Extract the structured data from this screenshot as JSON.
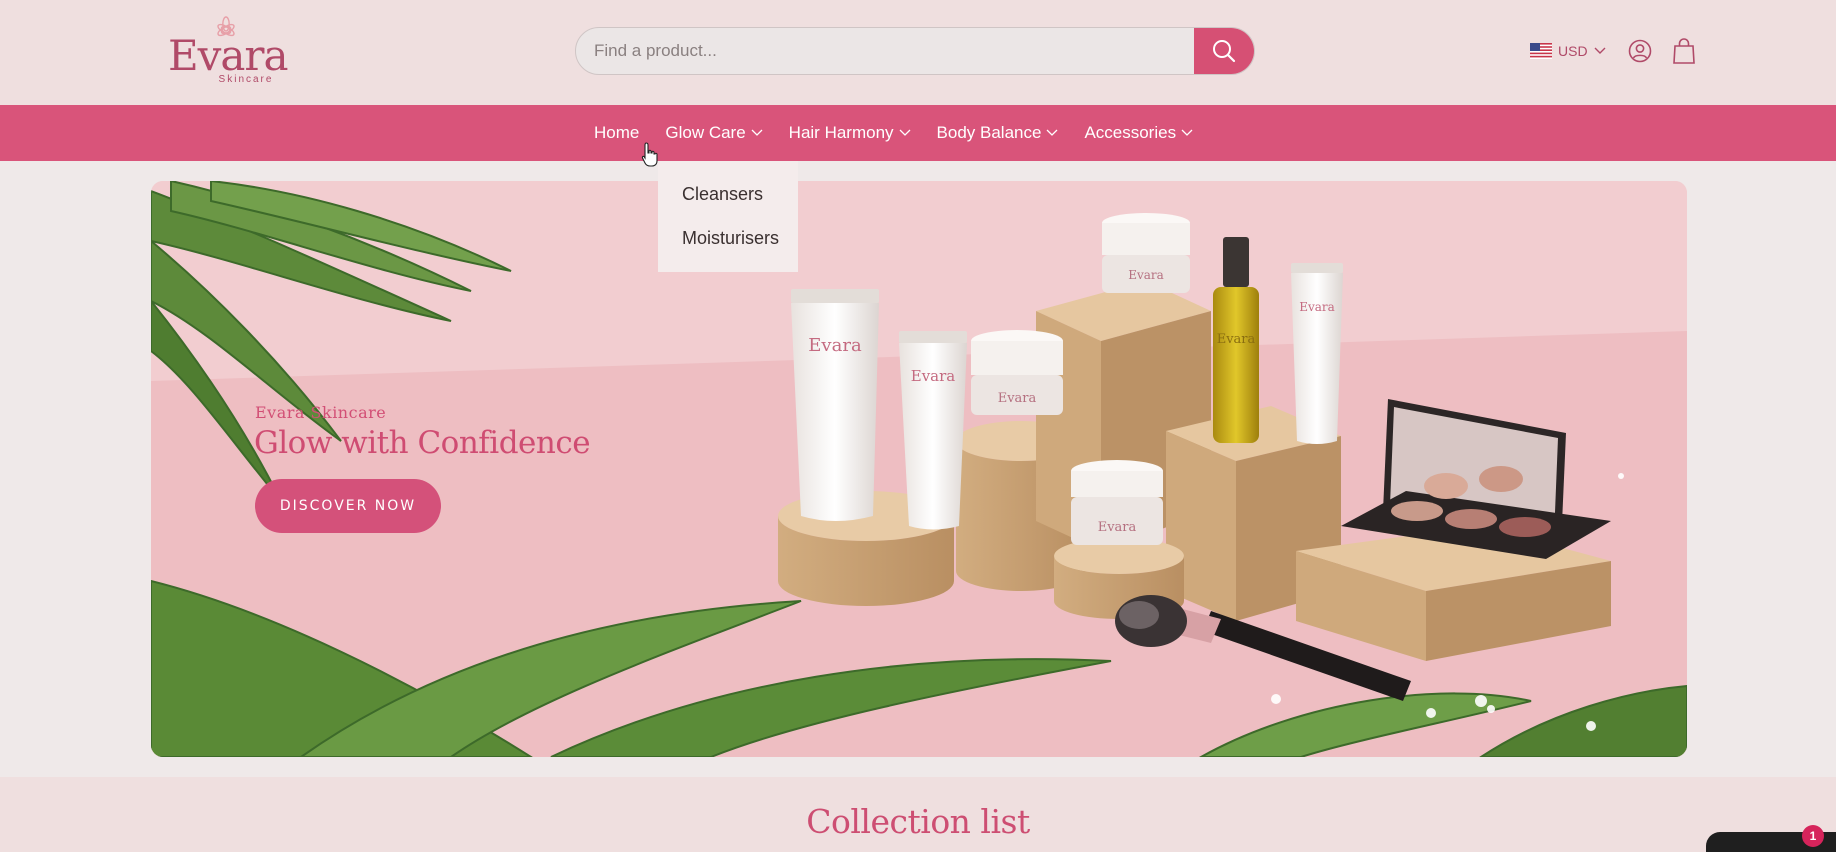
{
  "brand": {
    "name": "Evara",
    "tagline": "Skincare",
    "color": "#b04a68"
  },
  "search": {
    "placeholder": "Find a product...",
    "value": ""
  },
  "header": {
    "currency": "USD"
  },
  "nav": {
    "items": [
      {
        "label": "Home",
        "has_dropdown": false
      },
      {
        "label": "Glow Care",
        "has_dropdown": true
      },
      {
        "label": "Hair Harmony",
        "has_dropdown": true
      },
      {
        "label": "Body Balance",
        "has_dropdown": true
      },
      {
        "label": "Accessories",
        "has_dropdown": true
      }
    ],
    "color": "#d9547a"
  },
  "dropdown": {
    "items": [
      {
        "label": "Cleansers"
      },
      {
        "label": "Moisturisers"
      }
    ]
  },
  "hero": {
    "subtitle": "Evara Skincare",
    "title": "Glow with Confidence",
    "cta": "DISCOVER NOW",
    "product_label": "Evara"
  },
  "collection": {
    "title": "Collection list"
  },
  "chat": {
    "badge_count": "1"
  }
}
